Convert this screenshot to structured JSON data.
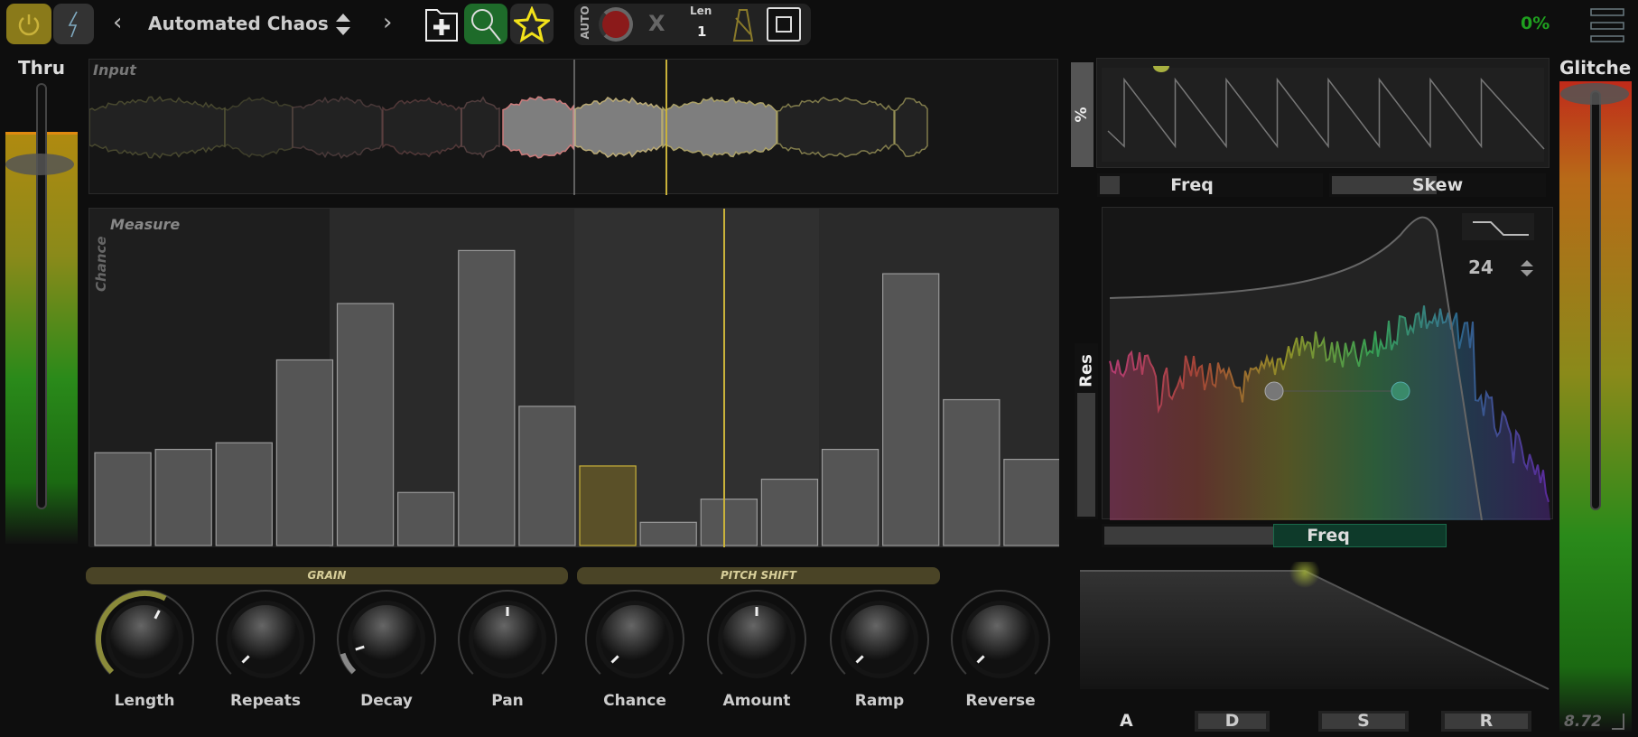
{
  "toolbar": {
    "preset_name": "Automated Chaos",
    "prev_label": "‹",
    "next_label": "›",
    "auto_label": "AUTO",
    "x_label": "X",
    "len_label": "Len",
    "len_value": "1",
    "cpu": "0%",
    "power_color": "#8a7a1a",
    "search_color": "#1e6b2a",
    "star_color": "#f2e21a",
    "cpu_color": "#1fa01f"
  },
  "meters": {
    "left_label": "Thru",
    "right_label": "Glitche",
    "left_level": 0.78,
    "right_level": 0.95
  },
  "input": {
    "label": "Input"
  },
  "measure": {
    "label": "Measure",
    "axis_label": "Chance",
    "values": [
      0.28,
      0.29,
      0.31,
      0.56,
      0.73,
      0.16,
      0.89,
      0.42,
      0.24,
      0.07,
      0.14,
      0.2,
      0.29,
      0.82,
      0.44,
      0.26
    ],
    "selected_index": 8,
    "accent": "#c9b23a"
  },
  "sections": {
    "grain": "GRAIN",
    "pitch_shift": "PITCH SHIFT"
  },
  "knobs": [
    {
      "label": "Length",
      "value": 0.6,
      "active": true
    },
    {
      "label": "Repeats",
      "value": 0.0
    },
    {
      "label": "Decay",
      "value": 0.1
    },
    {
      "label": "Pan",
      "value": 0.5
    },
    {
      "label": "Chance",
      "value": 0.0
    },
    {
      "label": "Amount",
      "value": 0.5
    },
    {
      "label": "Ramp",
      "value": 0.0
    },
    {
      "label": "Reverse",
      "value": 0.0
    }
  ],
  "lfo": {
    "tab_label": "%",
    "freq_label": "Freq",
    "skew_label": "Skew",
    "freq_value": 0.05,
    "skew_value": 0.4
  },
  "filter": {
    "res_label": "Res",
    "freq_label": "Freq",
    "slope": "24",
    "res_value": 0.6,
    "freq_value": 0.6
  },
  "envelope": {
    "a_label": "A",
    "d_label": "D",
    "s_label": "S",
    "r_label": "R",
    "d_value": 0.95,
    "s_value": 0.95,
    "r_value": 0.95,
    "version": "8.72"
  }
}
